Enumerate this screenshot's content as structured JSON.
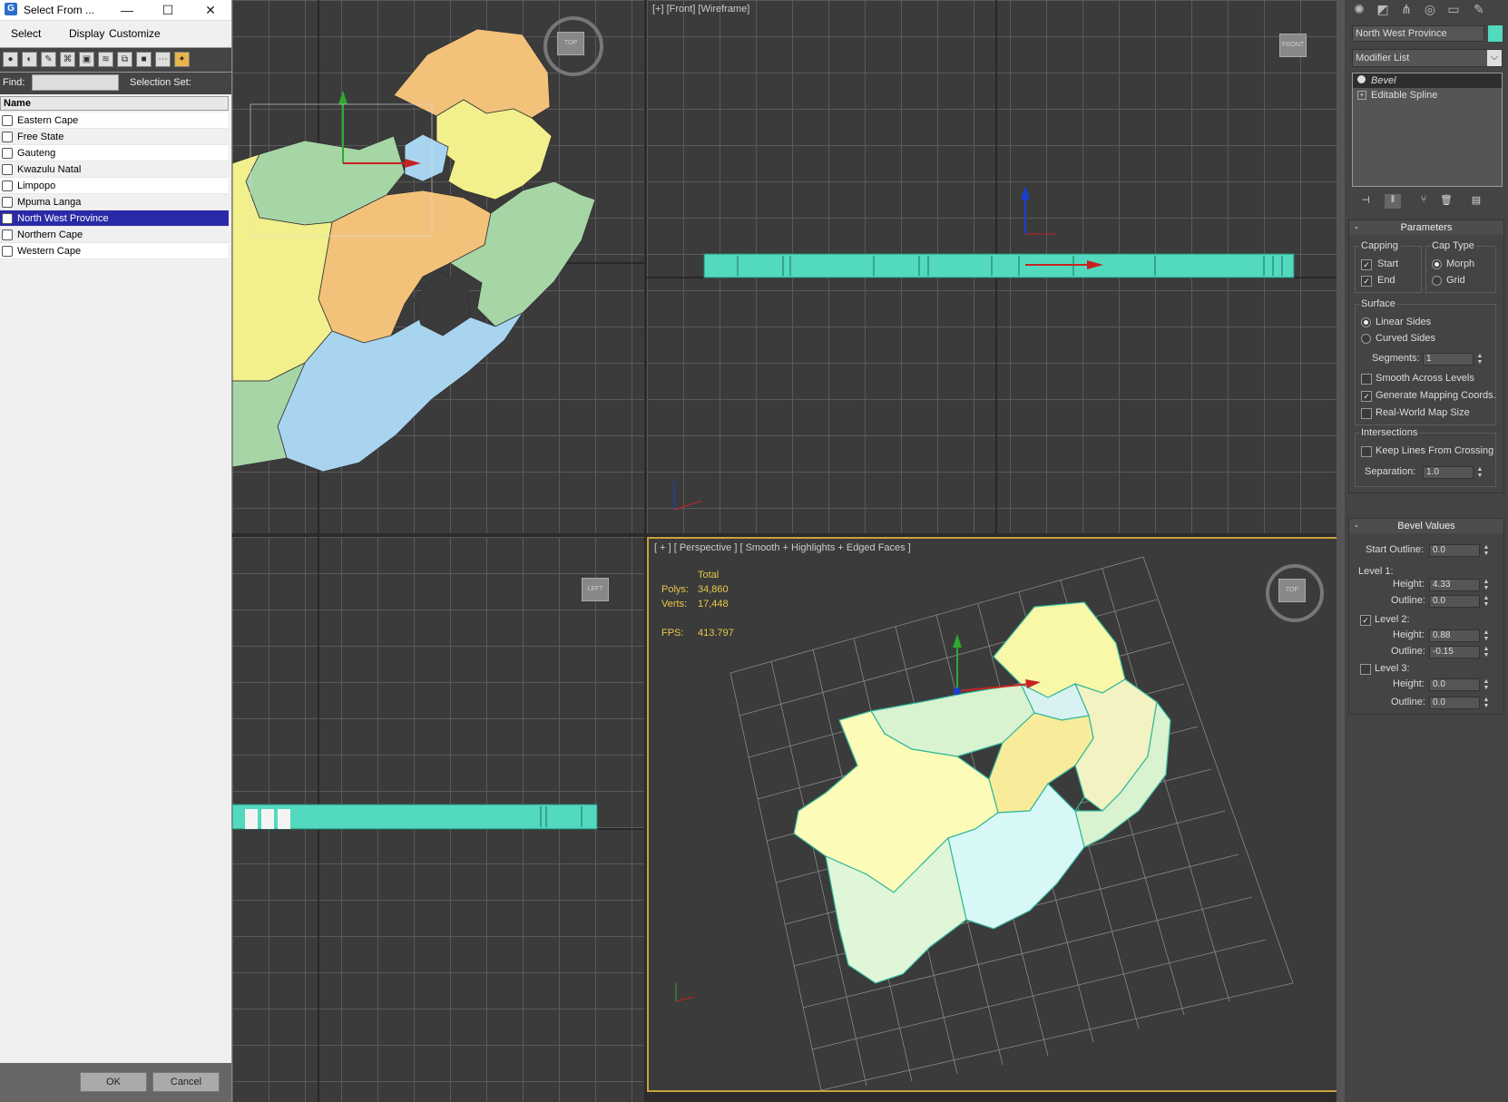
{
  "dialog": {
    "title": "Select From ...",
    "window_buttons": {
      "minimize": "—",
      "maximize": "☐",
      "close": "✕"
    },
    "menu": [
      "Select",
      "Display",
      "Customize"
    ],
    "find_label": "Find:",
    "find_value": "",
    "selection_set_label": "Selection Set:",
    "column_header": "Name",
    "items": [
      {
        "label": "Eastern Cape",
        "selected": false
      },
      {
        "label": "Free State",
        "selected": false
      },
      {
        "label": "Gauteng",
        "selected": false
      },
      {
        "label": "Kwazulu Natal",
        "selected": false
      },
      {
        "label": "Limpopo",
        "selected": false
      },
      {
        "label": "Mpuma Langa",
        "selected": false
      },
      {
        "label": "North West Province",
        "selected": true
      },
      {
        "label": "Northern Cape",
        "selected": false
      },
      {
        "label": "Western Cape",
        "selected": false
      }
    ],
    "ok_label": "OK",
    "cancel_label": "Cancel"
  },
  "viewports": {
    "top": {
      "label": "",
      "cube": "TOP"
    },
    "front": {
      "label": "[+] [Front] [Wireframe]",
      "cube": "FRONT"
    },
    "left": {
      "label": "",
      "cube": "LEFT"
    },
    "perspective": {
      "label": "[ + ] [ Perspective ] [ Smooth + Highlights + Edged Faces ]",
      "cube": "TOP",
      "stats": {
        "header": "Total",
        "polys_label": "Polys:",
        "polys_value": "34,860",
        "verts_label": "Verts:",
        "verts_value": "17,448",
        "fps_label": "FPS:",
        "fps_value": "413.797"
      }
    }
  },
  "command_panel": {
    "object_name": "North West Province",
    "object_color": "#52d9be",
    "modifier_list_label": "Modifier List",
    "stack": [
      {
        "label": "Bevel",
        "active": true
      },
      {
        "label": "Editable Spline",
        "active": false
      }
    ],
    "parameters": {
      "title": "Parameters",
      "capping_title": "Capping",
      "capping_start": "Start",
      "capping_end": "End",
      "cap_type_title": "Cap Type",
      "cap_morph": "Morph",
      "cap_grid": "Grid",
      "surface_title": "Surface",
      "linear_sides": "Linear Sides",
      "curved_sides": "Curved Sides",
      "segments_label": "Segments:",
      "segments_value": "1",
      "smooth_across": "Smooth Across Levels",
      "gen_mapping": "Generate Mapping Coords.",
      "real_world": "Real-World Map Size",
      "intersections_title": "Intersections",
      "keep_lines": "Keep Lines From Crossing",
      "separation_label": "Separation:",
      "separation_value": "1.0"
    },
    "bevel_values": {
      "title": "Bevel Values",
      "start_outline_label": "Start Outline:",
      "start_outline_value": "0.0",
      "level1_label": "Level 1:",
      "level1_height_label": "Height:",
      "level1_height_value": "4.33",
      "level1_outline_label": "Outline:",
      "level1_outline_value": "0.0",
      "level2_label": "Level 2:",
      "level2_height_label": "Height:",
      "level2_height_value": "0.88",
      "level2_outline_label": "Outline:",
      "level2_outline_value": "-0.15",
      "level3_label": "Level 3:",
      "level3_height_label": "Height:",
      "level3_height_value": "0.0",
      "level3_outline_label": "Outline:",
      "level3_outline_value": "0.0"
    }
  }
}
